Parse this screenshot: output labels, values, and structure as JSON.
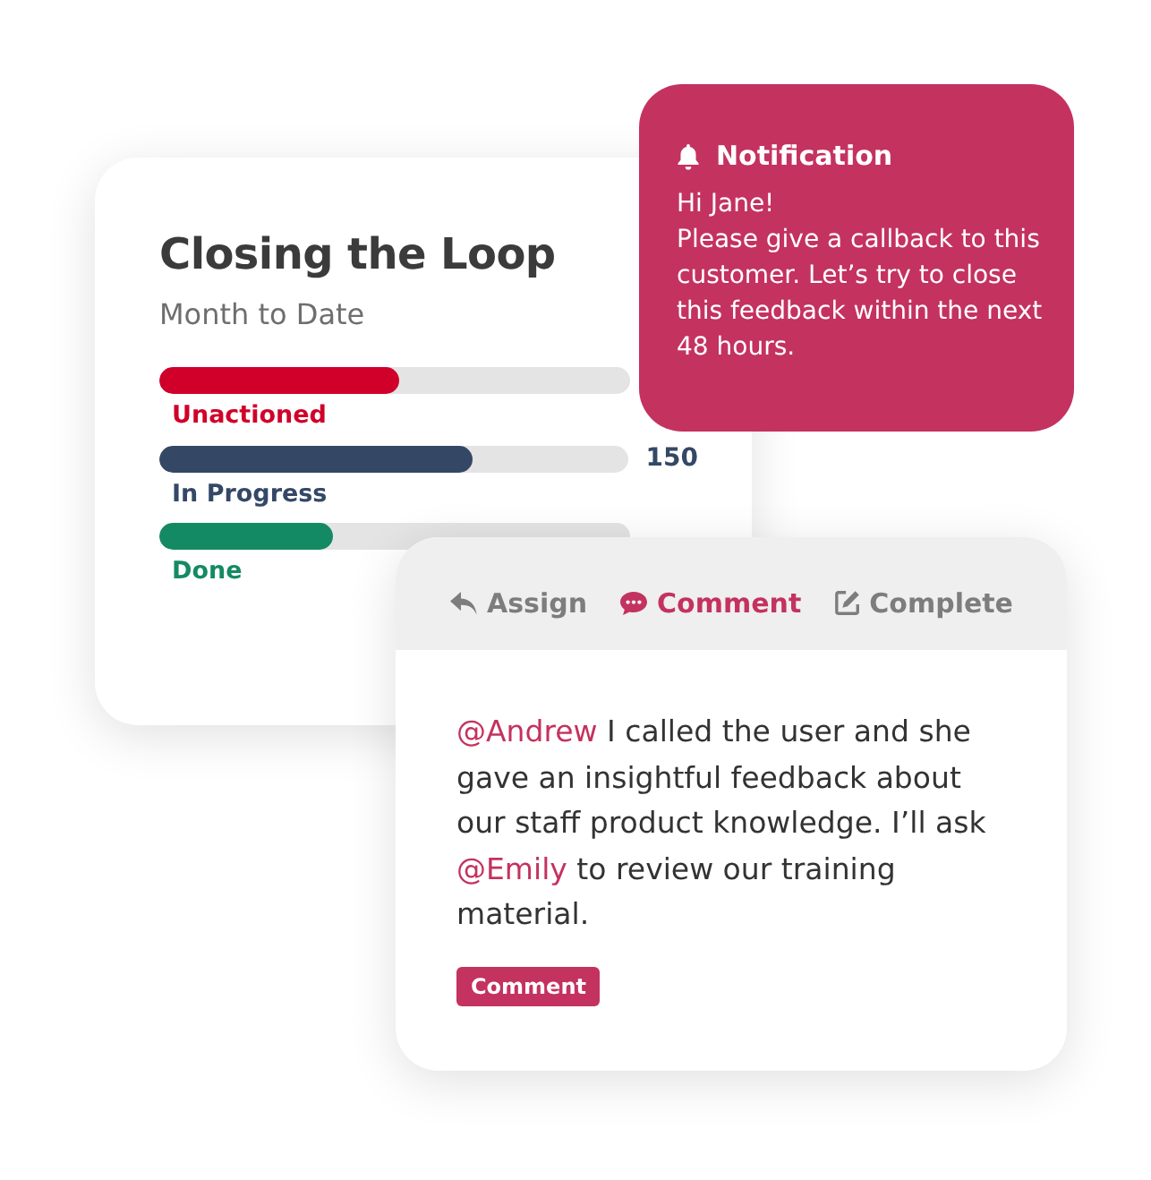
{
  "summary_card": {
    "title": "Closing the Loop",
    "subtitle": "Month to Date",
    "bars": [
      {
        "label": "Unactioned",
        "level": 0.51,
        "color": "#d0002a"
      },
      {
        "label": "In Progress",
        "level": 0.67,
        "color": "#344866",
        "count": "150"
      },
      {
        "label": "Done",
        "level": 0.37,
        "color": "#138a63"
      }
    ]
  },
  "notification": {
    "title": "Notification",
    "greeting": "Hi Jane!",
    "message": "Please give a callback to this customer. Let’s try to close this feedback within the next 48 hours."
  },
  "comment_card": {
    "tabs": [
      {
        "label": "Assign",
        "kind": "assign",
        "selected": false
      },
      {
        "label": "Comment",
        "kind": "comment",
        "selected": true
      },
      {
        "label": "Complete",
        "kind": "complete",
        "selected": false
      }
    ],
    "comment": [
      {
        "kind": "mention",
        "text": "@Andrew"
      },
      {
        "kind": "plain",
        "text": " I called the user and she gave an insightful feedback about our staff product knowledge. I’ll ask "
      },
      {
        "kind": "mention",
        "text": "@Emily"
      },
      {
        "kind": "plain",
        "text": " to review our training material."
      }
    ],
    "tag": "Comment"
  }
}
